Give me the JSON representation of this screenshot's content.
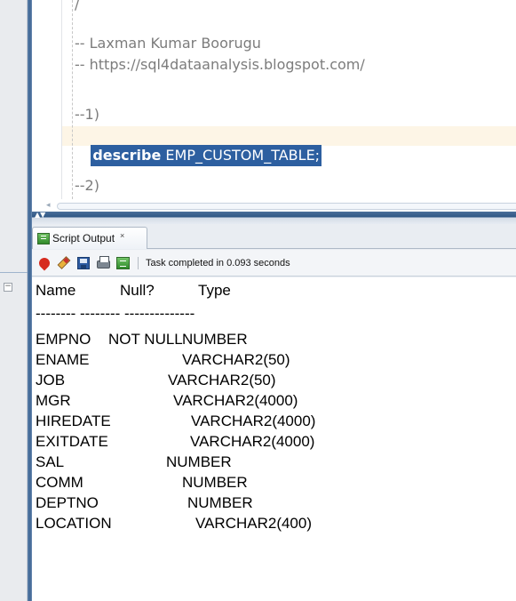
{
  "editor": {
    "lines": [
      {
        "text": "/",
        "kind": "comment"
      },
      {
        "text": "-- Laxman Kumar Boorugu",
        "kind": "comment"
      },
      {
        "text": "-- https://sql4dataanalysis.blogspot.com/",
        "kind": "comment"
      },
      {
        "text": "--1)",
        "kind": "comment"
      },
      {
        "keyword": "describe",
        "rest": " EMP_CUSTOM_TABLE;",
        "kind": "selected"
      },
      {
        "text": "--2)",
        "kind": "comment"
      }
    ]
  },
  "output_panel": {
    "tab_label": "Script Output",
    "tab_close": "×",
    "status": "Task completed in 0.093 seconds",
    "toolbar_icons": [
      "pin-icon",
      "eraser-icon",
      "save-icon",
      "print-icon",
      "run-script-icon"
    ],
    "header": {
      "name": "Name",
      "null": "Null?",
      "type": "Type"
    },
    "separator": "-------- -------- --------------",
    "rows": [
      {
        "name": "EMPNO",
        "null": "NOT NULL",
        "type": "NUMBER"
      },
      {
        "name": "ENAME",
        "null": "",
        "type": "VARCHAR2(50)"
      },
      {
        "name": "JOB",
        "null": "",
        "type": "VARCHAR2(50)"
      },
      {
        "name": "MGR",
        "null": "",
        "type": "VARCHAR2(4000)"
      },
      {
        "name": "HIREDATE",
        "null": "",
        "type": "VARCHAR2(4000)"
      },
      {
        "name": "EXITDATE",
        "null": "",
        "type": "VARCHAR2(4000)"
      },
      {
        "name": "SAL",
        "null": "",
        "type": "NUMBER"
      },
      {
        "name": "COMM",
        "null": "",
        "type": "NUMBER"
      },
      {
        "name": "DEPTNO",
        "null": "",
        "type": "NUMBER"
      },
      {
        "name": "LOCATION",
        "null": "",
        "type": "VARCHAR2(400)"
      }
    ]
  },
  "colors": {
    "selection": "#2d5fa0",
    "current_line": "#fdf5e6",
    "comment": "#7c7c7c",
    "splitter": "#2f5684"
  }
}
